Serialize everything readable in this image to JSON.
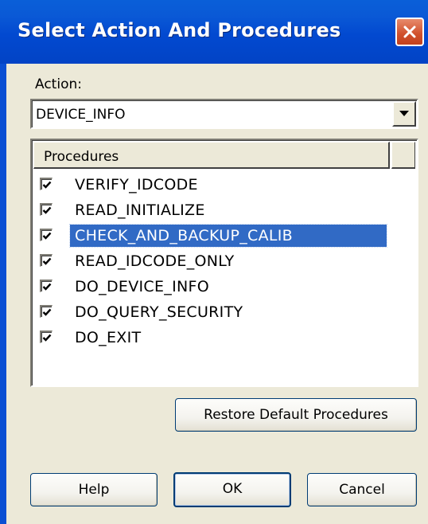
{
  "window": {
    "title": "Select Action And Procedures",
    "close_icon": "close-icon",
    "title_color": "#0a59d6"
  },
  "action": {
    "label": "Action:",
    "value": "DEVICE_INFO"
  },
  "procedures": {
    "header": "Procedures",
    "selected_color": "#316ac5",
    "items": [
      {
        "label": "VERIFY_IDCODE",
        "checked": true
      },
      {
        "label": "READ_INITIALIZE",
        "checked": true
      },
      {
        "label": "CHECK_AND_BACKUP_CALIB",
        "checked": true,
        "selected": true
      },
      {
        "label": "READ_IDCODE_ONLY",
        "checked": true
      },
      {
        "label": "DO_DEVICE_INFO",
        "checked": true
      },
      {
        "label": "DO_QUERY_SECURITY",
        "checked": true
      },
      {
        "label": "DO_EXIT",
        "checked": true
      }
    ]
  },
  "buttons": {
    "restore": "Restore Default Procedures",
    "help": "Help",
    "ok": "OK",
    "cancel": "Cancel"
  }
}
